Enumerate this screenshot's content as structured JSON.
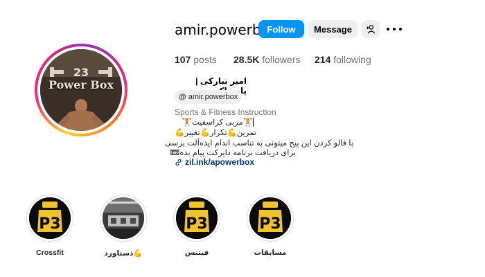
{
  "profile": {
    "username": "amir.powerbox",
    "avatar_logo_text": "Power Box",
    "full_name": "امیر تبارکی | پاورباکس",
    "threads_handle": "amir.powerbox",
    "category": "Sports & Fitness Instruction",
    "bio": [
      "🏋مربی کراسفیت🏋",
      "تمرین💪تکرار💪تغییر💪",
      "با فالو کردن این پیج میتونی به تناسب اندام ایده‌آلت برسی",
      "برای دریافت برنامه دایرکت پیام بده📼"
    ],
    "link": "zil.ink/apowerbox"
  },
  "actions": {
    "follow": "Follow",
    "message": "Message",
    "add_user_icon": "add-user-icon",
    "more_icon": "more-options-icon"
  },
  "stats": {
    "posts_count": "107",
    "posts_label": " posts",
    "followers_count": "28.5K",
    "followers_label": " followers",
    "following_count": "214",
    "following_label": " following"
  },
  "highlights": [
    {
      "label": "Crossfit",
      "icon": "p23-logo"
    },
    {
      "label": "دستاورد💪",
      "icon": "gym-photo"
    },
    {
      "label": "فیتنس",
      "icon": "p23-logo"
    },
    {
      "label": "مسابقات",
      "icon": "p23-logo"
    }
  ],
  "colors": {
    "accent": "#0095f6",
    "link": "#00376b",
    "muted": "#737373",
    "logo_yellow": "#f2c230"
  }
}
